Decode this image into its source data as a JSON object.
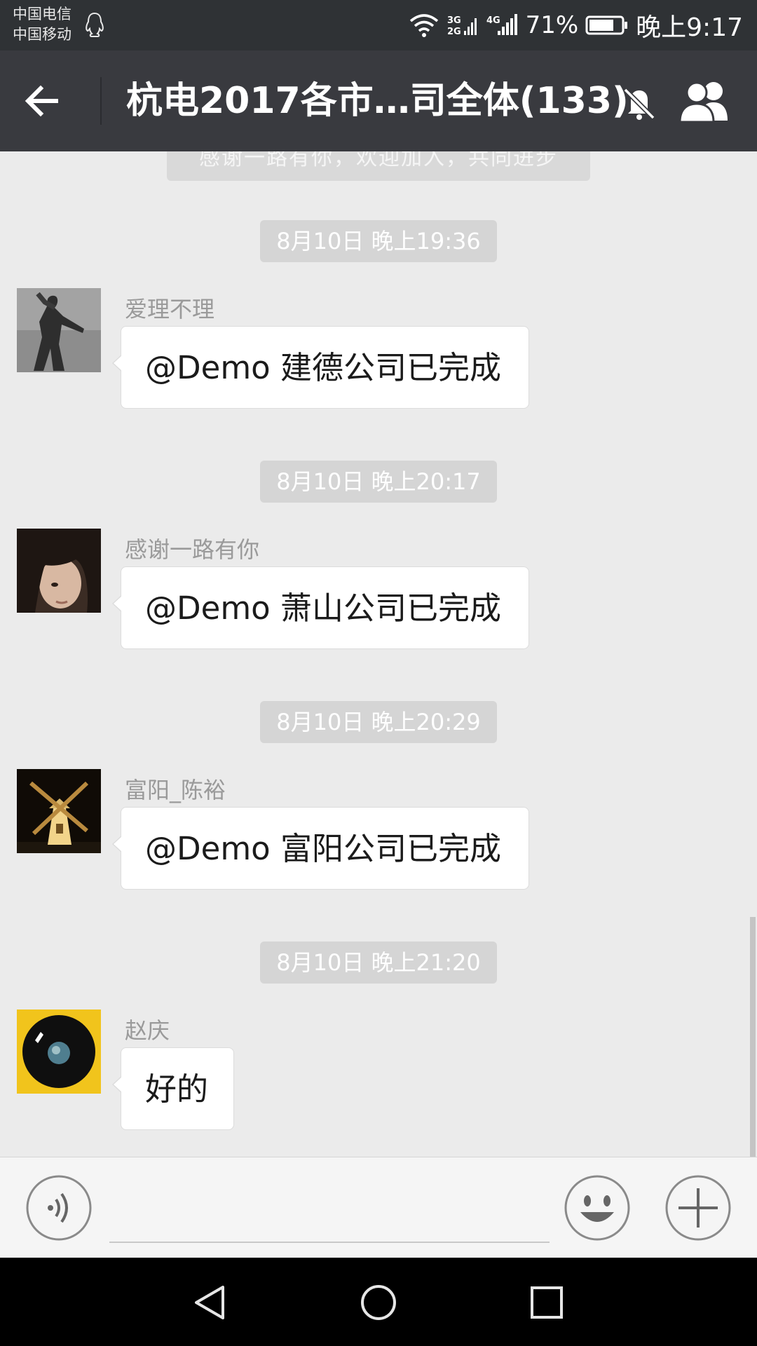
{
  "status_bar": {
    "carrier_1": "中国电信",
    "carrier_2": "中国移动",
    "network_top": "3G",
    "network_bottom": "2G",
    "network_4g": "4G",
    "battery": "71%",
    "time": "晚上9:17",
    "icons": [
      "qq-icon",
      "wifi-icon",
      "signal-icon",
      "battery-icon"
    ]
  },
  "header": {
    "title": "杭电2017各市…司全体(133)",
    "icons": [
      "back-arrow-icon",
      "mute-bell-icon",
      "members-icon"
    ]
  },
  "messages": [
    {
      "timestamp": "8月10日 晚上19:36",
      "sender": "爱理不理",
      "text": "@Demo 建德公司已完成",
      "avatar": "statue-avatar"
    },
    {
      "timestamp": "8月10日 晚上20:17",
      "sender": "感谢一路有你",
      "text": "@Demo 萧山公司已完成",
      "avatar": "face-avatar"
    },
    {
      "timestamp": "8月10日 晚上20:29",
      "sender": "富阳_陈裕",
      "text": "@Demo 富阳公司已完成",
      "avatar": "windmill-avatar"
    },
    {
      "timestamp": "8月10日 晚上21:20",
      "sender": "赵庆",
      "text": "好的",
      "avatar": "planet-avatar"
    }
  ],
  "input_bar": {
    "placeholder": "",
    "icons": [
      "voice-icon",
      "emoji-icon",
      "plus-icon"
    ]
  },
  "nav_bar": {
    "icons": [
      "nav-back-icon",
      "nav-home-icon",
      "nav-recent-icon"
    ]
  },
  "colors": {
    "status_bar_bg": "#2f3235",
    "title_bar_bg": "#393a3f",
    "chat_bg": "#ebebeb",
    "timestamp_bg": "#d5d5d5",
    "bubble_bg": "#ffffff",
    "input_bar_bg": "#f5f5f5",
    "nav_bar_bg": "#000000"
  }
}
